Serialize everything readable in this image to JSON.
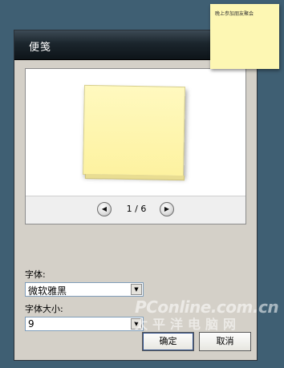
{
  "window": {
    "title": "便笺"
  },
  "preview": {
    "page_current": "1",
    "page_total": "6",
    "page_text": "1 / 6"
  },
  "font": {
    "label": "字体:",
    "value": "微软雅黑"
  },
  "font_size": {
    "label": "字体大小:",
    "value": "9"
  },
  "buttons": {
    "ok": "确定",
    "cancel": "取消"
  },
  "sticky_note": {
    "text": "晚上参加朋友聚会"
  },
  "watermark": {
    "line1": "PConline.com.cn",
    "line2": "太平洋电脑网"
  },
  "icons": {
    "prev": "chevron-left-icon",
    "next": "chevron-right-icon",
    "dropdown": "chevron-down-icon"
  }
}
